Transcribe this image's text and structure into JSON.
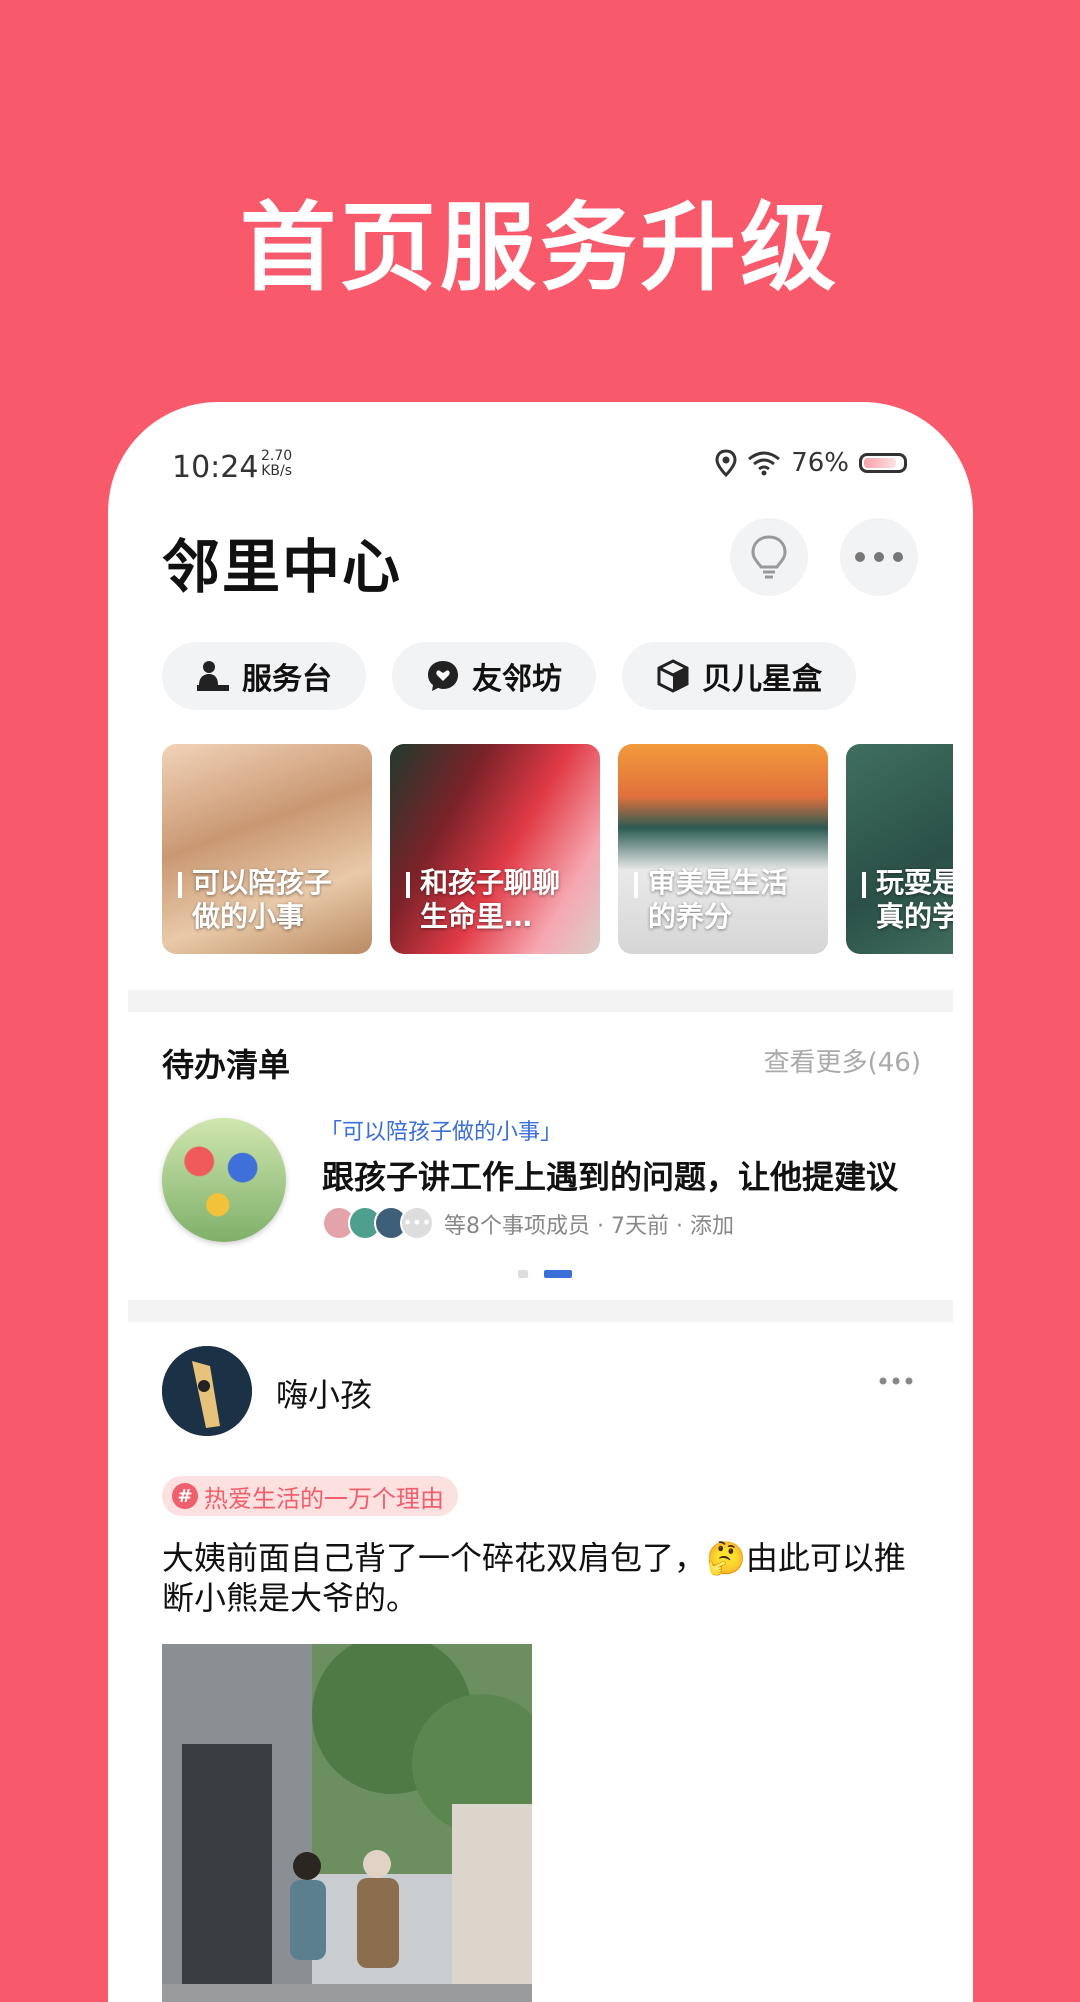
{
  "banner": {
    "title": "首页服务升级"
  },
  "status_bar": {
    "time": "10:24",
    "speed_value": "2.70",
    "speed_unit": "KB/s",
    "battery": "76%"
  },
  "header": {
    "title": "邻里中心"
  },
  "chips": [
    {
      "label": "服务台",
      "icon": "desk-icon"
    },
    {
      "label": "友邻坊",
      "icon": "chat-bubble-icon"
    },
    {
      "label": "贝儿星盒",
      "icon": "box-icon"
    }
  ],
  "cards": [
    {
      "line1": "可以陪孩子",
      "line2": "做的小事"
    },
    {
      "line1": "和孩子聊聊",
      "line2": "生命里…"
    },
    {
      "line1": "审美是生活",
      "line2": "的养分"
    },
    {
      "line1": "玩耍是",
      "line2": "真的学"
    }
  ],
  "todo": {
    "title": "待办清单",
    "more": "查看更多(46)",
    "tag": "「可以陪孩子做的小事」",
    "main": "跟孩子讲工作上遇到的问题，让他提建议",
    "meta": "等8个事项成员 · 7天前 · 添加",
    "page": "2 / 2"
  },
  "post": {
    "author": "嗨小孩",
    "topic": "热爱生活的一万个理由",
    "text_before": "大姨前面自己背了一个碎花双肩包了，",
    "emoji": "🤔",
    "text_after": "由此可以推断小熊是大爷的。"
  },
  "colors": {
    "background": "#f85a6b",
    "accent_blue": "#3a6fd8",
    "topic_red": "#f0606c"
  }
}
